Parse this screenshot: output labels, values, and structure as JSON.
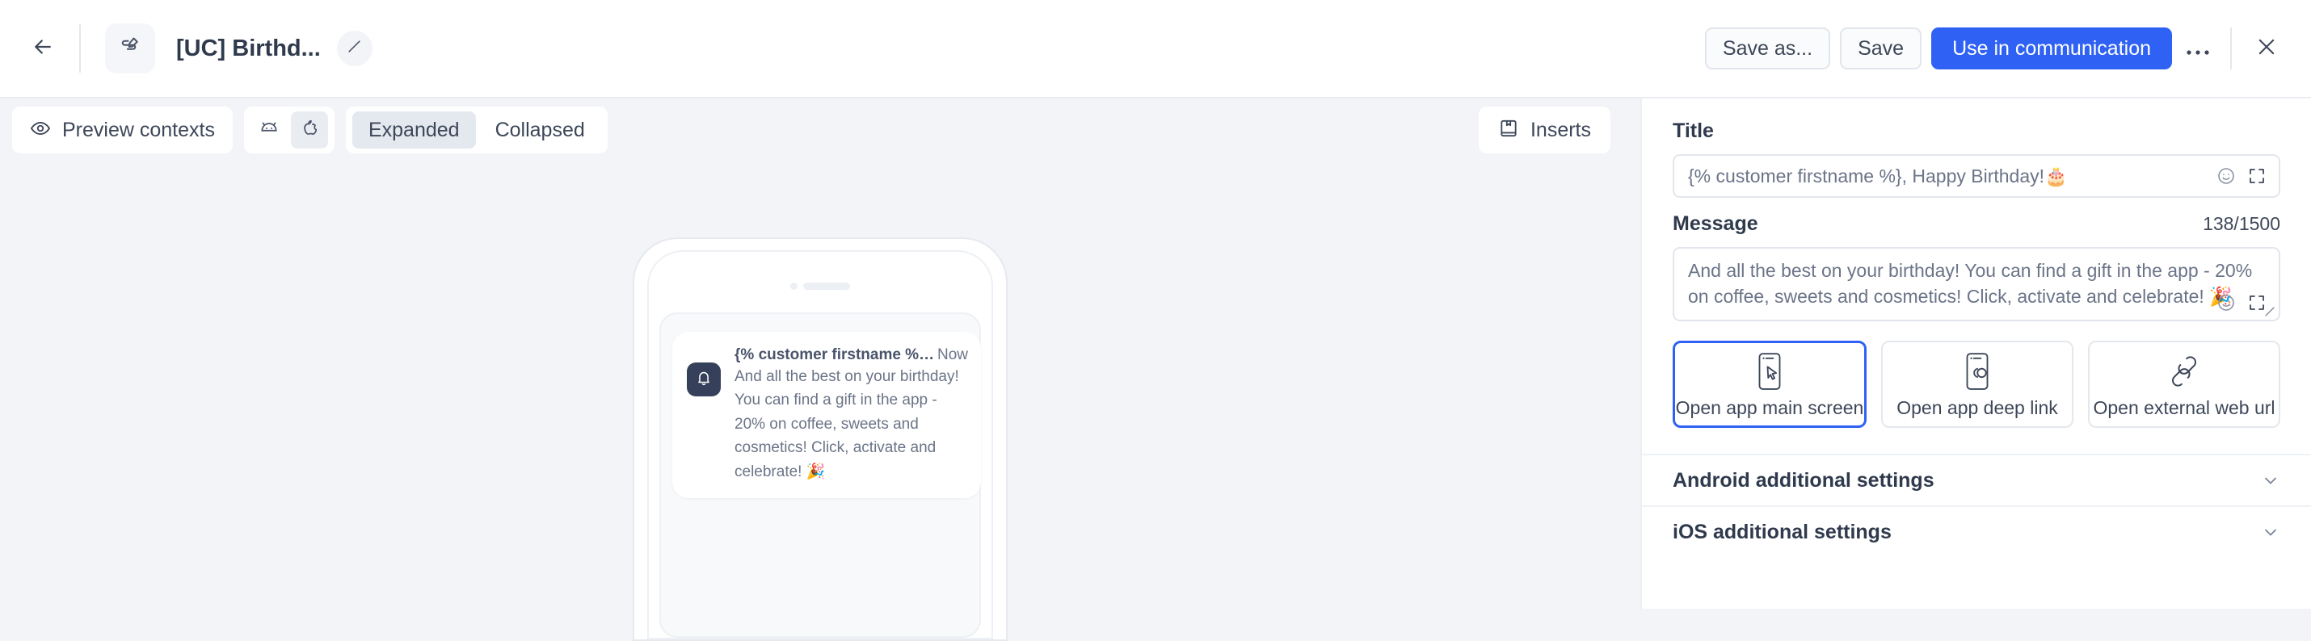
{
  "header": {
    "back_icon": "arrow-left-icon",
    "app_icon": "push-edit-icon",
    "title": "[UC] Birthd...",
    "edit_icon": "pencil-icon",
    "save_as_label": "Save as...",
    "save_label": "Save",
    "primary_label": "Use in communication",
    "more_label": "•••",
    "close_icon": "close-icon"
  },
  "toolbar": {
    "preview_icon": "eye-icon",
    "preview_label": "Preview contexts",
    "os_options": [
      {
        "key": "android",
        "icon": "android-icon",
        "active": false
      },
      {
        "key": "ios",
        "icon": "apple-icon",
        "active": true
      }
    ],
    "state_options": [
      {
        "label": "Expanded",
        "active": true
      },
      {
        "label": "Collapsed",
        "active": false
      }
    ],
    "inserts_icon": "book-icon",
    "inserts_label": "Inserts"
  },
  "preview": {
    "notification": {
      "app_icon": "bell-icon",
      "title": "{% customer firstname %}, Hap...",
      "time": "Now",
      "body": "And all the best on your birthday! You can find a gift in the app - 20% on coffee, sweets and cosmetics! Click, activate and celebrate! 🎉"
    }
  },
  "panel": {
    "title_field": {
      "label": "Title",
      "value": "{% customer firstname %}, Happy Birthday!🎂",
      "emoji_icon": "emoji-icon",
      "expand_icon": "expand-icon"
    },
    "message_field": {
      "label": "Message",
      "counter": "138/1500",
      "value": "And all the best on your birthday! You can find a gift in the app - 20% on coffee, sweets and cosmetics! Click, activate and celebrate! 🎉",
      "emoji_icon": "emoji-icon",
      "expand_icon": "expand-icon",
      "resize_icon": "resize-grip-icon"
    },
    "action_cards": [
      {
        "label": "Open app main screen",
        "icon": "phone-cursor-icon",
        "selected": true
      },
      {
        "label": "Open app deep link",
        "icon": "phone-link-icon",
        "selected": false
      },
      {
        "label": "Open external web url",
        "icon": "link-icon",
        "selected": false
      }
    ],
    "accordions": [
      {
        "label": "Android additional settings",
        "chevron": "chevron-down-icon"
      },
      {
        "label": "iOS additional settings",
        "chevron": "chevron-down-icon"
      }
    ]
  },
  "colors": {
    "accent": "#2f62f4",
    "page_bg": "#f2f4f7",
    "surface": "#ffffff",
    "text": "#3d4759",
    "muted": "#6b7488",
    "border": "#e2e6ec",
    "notif_icon_bg": "#36405a"
  }
}
